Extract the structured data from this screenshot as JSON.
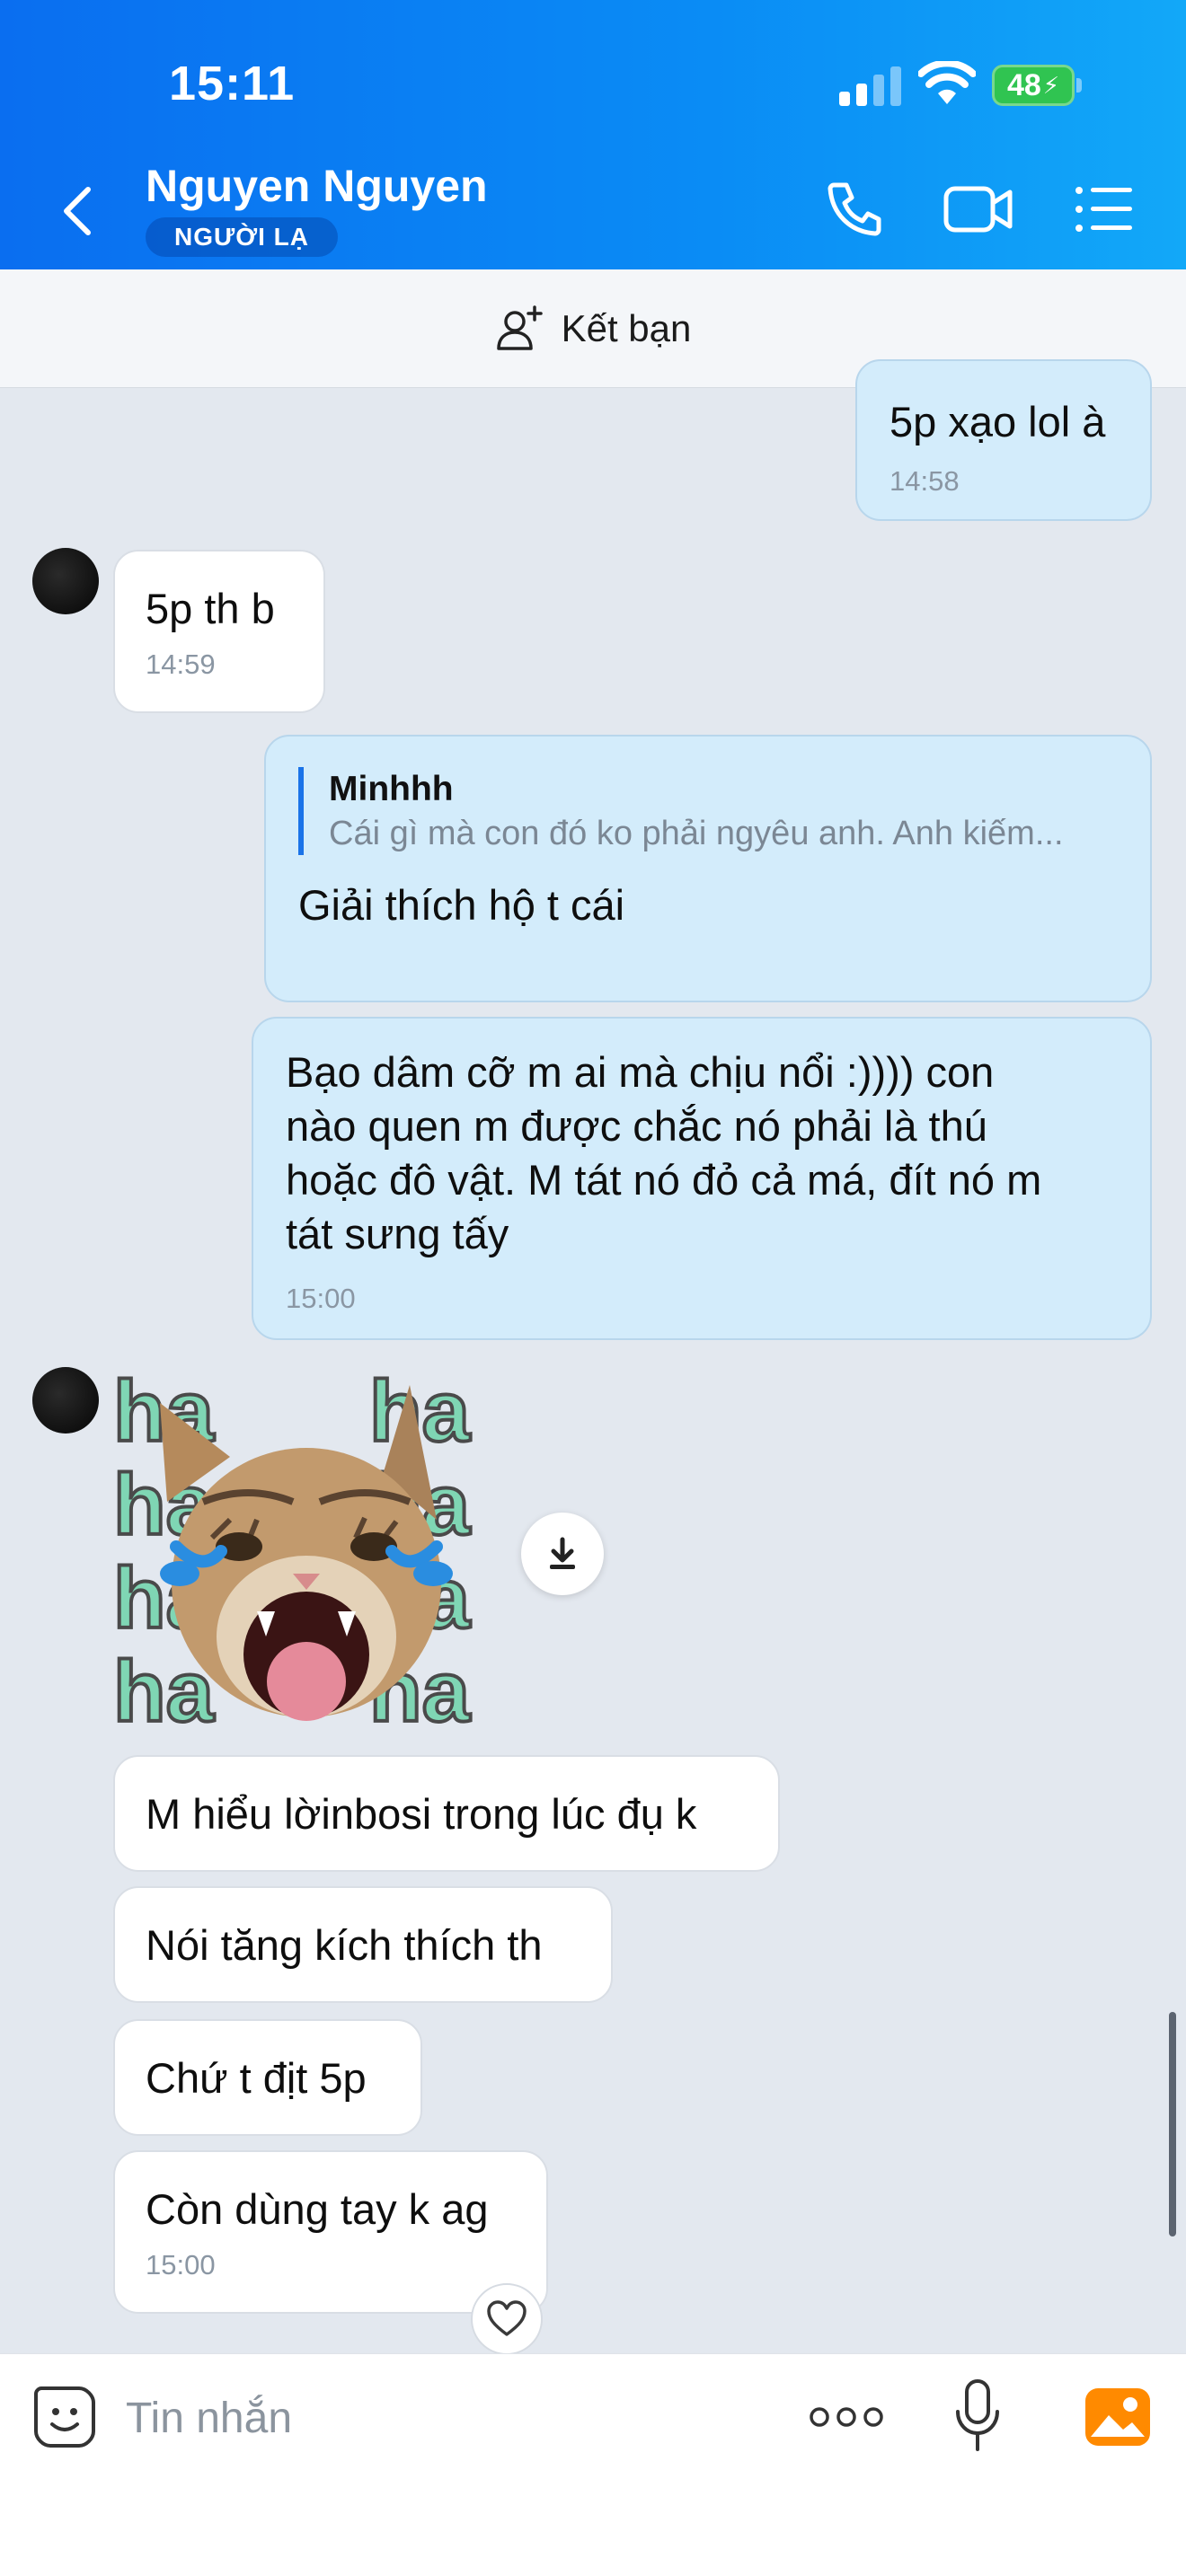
{
  "status_bar": {
    "time": "15:11",
    "battery": "48"
  },
  "header": {
    "contact_name": "Nguyen Nguyen",
    "badge": "NGƯỜI LẠ"
  },
  "add_friend": {
    "label": "Kết bạn"
  },
  "messages": [
    {
      "direction": "out",
      "text": "5p xạo lol à",
      "time": "14:58"
    },
    {
      "direction": "in",
      "text": "5p th b",
      "time": "14:59"
    },
    {
      "direction": "out",
      "quote_name": "Minhhh",
      "quote_text": "Cái gì mà con đó ko phải ngyêu anh. Anh kiếm...",
      "text": "Giải thích hộ t cái"
    },
    {
      "direction": "out",
      "lines": [
        "Bạo dâm cỡ m ai mà chịu nổi :)))) con",
        "nào quen m được chắc nó phải là thú",
        "hoặc đô vật. M tát nó đỏ cả má, đít nó m",
        "tát sưng tấy"
      ],
      "time": "15:00"
    },
    {
      "direction": "in",
      "sticker": "laughing-cat-haha",
      "sticker_text": "ha"
    },
    {
      "direction": "in",
      "text": "M hiểu lờinbosi trong lúc đụ k"
    },
    {
      "direction": "in",
      "text": "Nói tăng kích thích th"
    },
    {
      "direction": "in",
      "text": "Chứ t địt 5p"
    },
    {
      "direction": "in",
      "text": "Còn dùng tay k ag",
      "time": "15:00"
    }
  ],
  "input": {
    "placeholder": "Tin nhắn"
  },
  "colors": {
    "header_start": "#0a6ef0",
    "header_end": "#12a8f8",
    "bubble_out": "#d3ecfb",
    "bubble_in": "#ffffff",
    "chat_bg": "#e3e8ef"
  }
}
